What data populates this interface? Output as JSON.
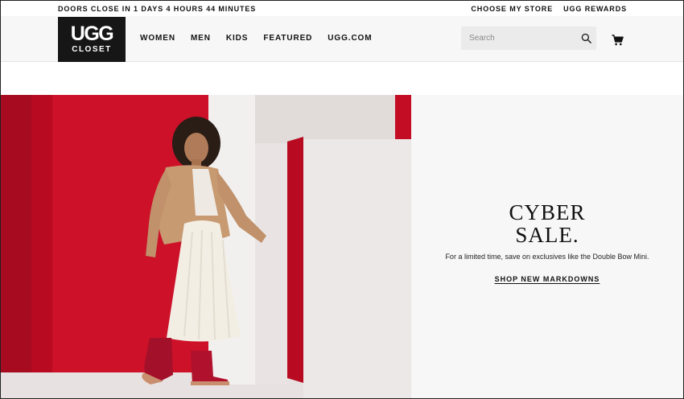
{
  "promo": {
    "countdown": "DOORS CLOSE IN 1 DAYS 4 HOURS 44 MINUTES",
    "links": [
      "CHOOSE MY STORE",
      "UGG REWARDS"
    ]
  },
  "header": {
    "logo": {
      "word": "UGG",
      "sub": "CLOSET"
    },
    "nav": [
      "WOMEN",
      "MEN",
      "KIDS",
      "FEATURED",
      "UGG.COM"
    ],
    "search": {
      "placeholder": "Search",
      "value": ""
    },
    "icons": {
      "search": "search-icon",
      "cart": "shopping-cart-icon"
    }
  },
  "hero": {
    "headline_line1": "CYBER",
    "headline_line2": "SALE.",
    "subtext": "For a limited time, save on exclusives like the Double Bow Mini.",
    "cta": "SHOP NEW MARKDOWNS",
    "colors": {
      "red": "#c8102e",
      "copy_bg": "#f7f7f7"
    }
  }
}
